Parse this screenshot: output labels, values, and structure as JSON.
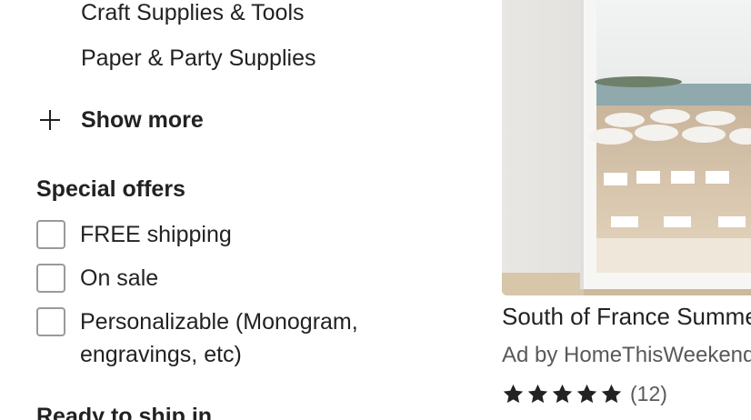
{
  "filters": {
    "categories": [
      {
        "label": "Craft Supplies & Tools"
      },
      {
        "label": "Paper & Party Supplies"
      }
    ],
    "show_more_label": "Show more",
    "special_offers": {
      "title": "Special offers",
      "options": [
        {
          "label": "FREE shipping",
          "checked": false
        },
        {
          "label": "On sale",
          "checked": false
        },
        {
          "label": "Personalizable (Monogram, engravings, etc)",
          "checked": false
        }
      ]
    },
    "ready_to_ship": {
      "title": "Ready to ship in"
    }
  },
  "product": {
    "title": "South of France Summer",
    "ad_line": "Ad by HomeThisWeekend",
    "rating": 5,
    "review_count": "(12)",
    "star_color": "#222222",
    "icons": {
      "star": "star-icon",
      "plus": "plus-icon"
    }
  }
}
